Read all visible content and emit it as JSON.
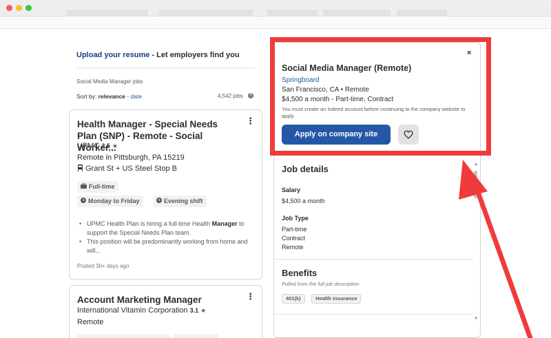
{
  "upload": {
    "link": "Upload your resume",
    "rest": " - Let employers find you"
  },
  "jobs_heading": "Social Media Manager jobs",
  "sort": {
    "label": "Sort by:",
    "relevance": "relevance",
    "separator": " - ",
    "date": "date"
  },
  "job_count": "4,542 jobs",
  "help_icon_glyph": "?",
  "kebab_glyph": "⋮",
  "cards": [
    {
      "title": "Health Manager - Special Needs Plan (SNP) - Remote - Social Worker...",
      "company": "UPMC",
      "rating": "3.5",
      "location": "Remote in Pittsburgh, PA 15219",
      "transit": "Grant St + US Steel Stop B",
      "tags": [
        "Full-time",
        "Monday to Friday",
        "Evening shift"
      ],
      "bullets": [
        {
          "pre": "UPMC Health Plan is hiring a full-time Health ",
          "bold": "Manager",
          "post": " to support the Special Needs Plan team."
        },
        {
          "pre": "This position will be predominantly working from home and will...",
          "bold": "",
          "post": ""
        }
      ],
      "posted": "Posted 30+ days ago"
    },
    {
      "title": "Account Marketing Manager",
      "company": "International Vitamin Corporation",
      "rating": "3.1",
      "location": "Remote"
    }
  ],
  "panel": {
    "title": "Social Media Manager (Remote)",
    "company": "Springboard",
    "location": "San Francisco, CA  •  Remote",
    "salary_line": "$4,500 a month  - Part-time, Contract",
    "note": "You must create an Indeed account before continuing to the company website to apply",
    "apply_label": "Apply on company site",
    "close_glyph": "×",
    "job_details_title": "Job details",
    "salary_label": "Salary",
    "salary_value": "$4,500 a month",
    "job_type_label": "Job Type",
    "job_types": [
      "Part-time",
      "Contract",
      "Remote"
    ],
    "benefits_title": "Benefits",
    "benefits_sub": "Pulled from the full job description",
    "benefits": [
      "401(k)",
      "Health insurance"
    ]
  },
  "colors": {
    "brand_blue": "#2557a7",
    "annotation_red": "#ef3b3b"
  }
}
